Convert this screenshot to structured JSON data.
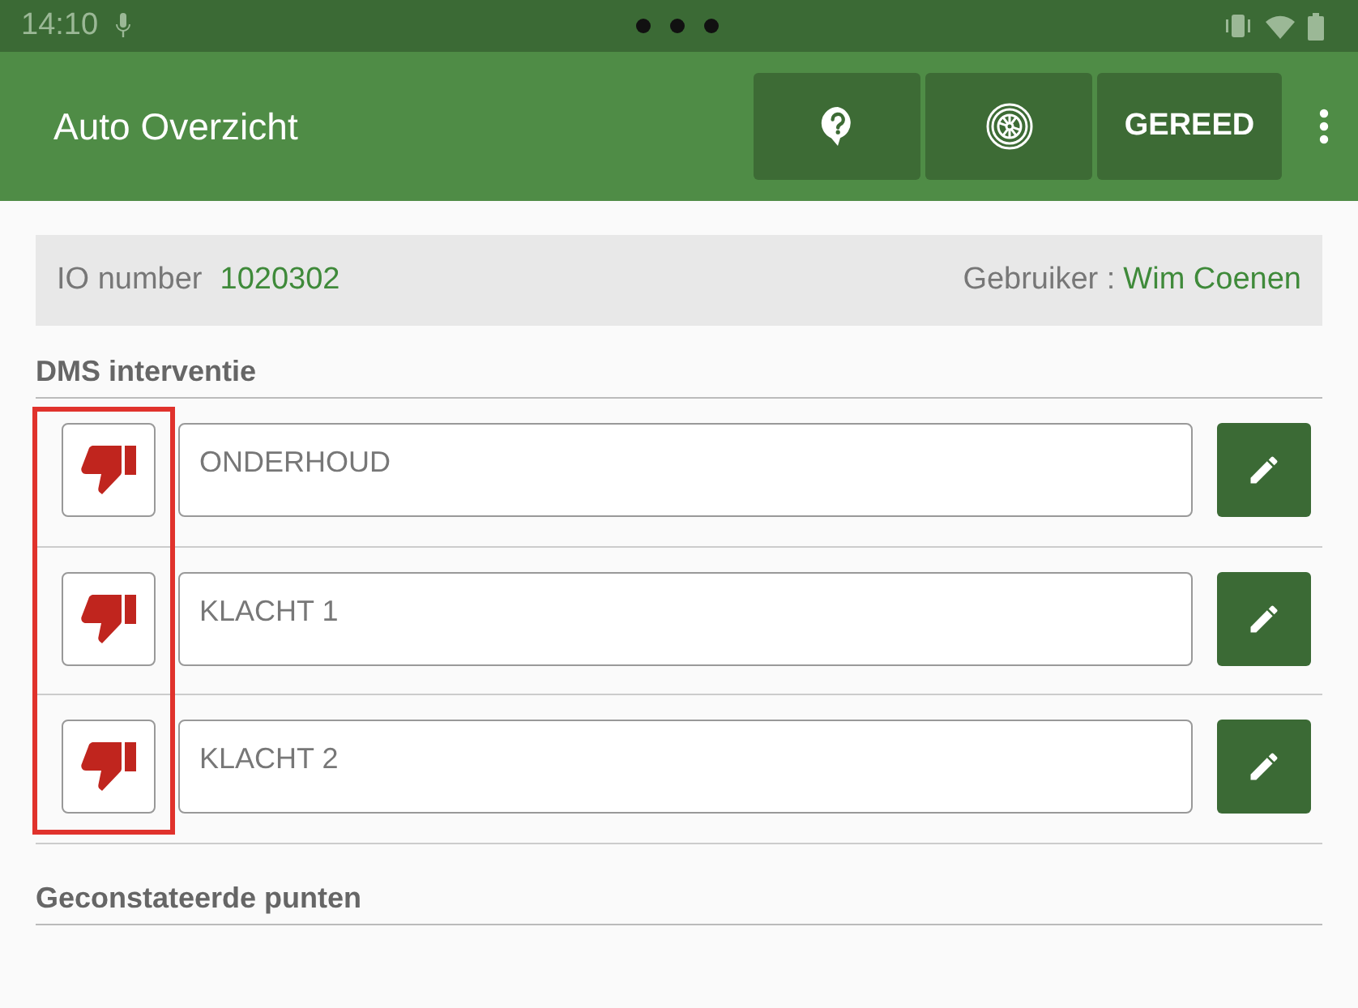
{
  "status_bar": {
    "time": "14:10"
  },
  "app_bar": {
    "title": "Auto Overzicht",
    "actions": [
      {
        "kind": "help"
      },
      {
        "kind": "wheel"
      },
      {
        "kind": "text",
        "label": "GEREED"
      }
    ]
  },
  "info": {
    "io_label": "IO number",
    "io_value": "1020302",
    "user_label": "Gebruiker :",
    "user_value": "Wim Coenen"
  },
  "sections": [
    {
      "title": "DMS interventie",
      "highlighted": true,
      "items": [
        {
          "value": "ONDERHOUD"
        },
        {
          "value": "KLACHT 1"
        },
        {
          "value": "KLACHT 2"
        }
      ]
    },
    {
      "title": "Geconstateerde punten"
    }
  ]
}
